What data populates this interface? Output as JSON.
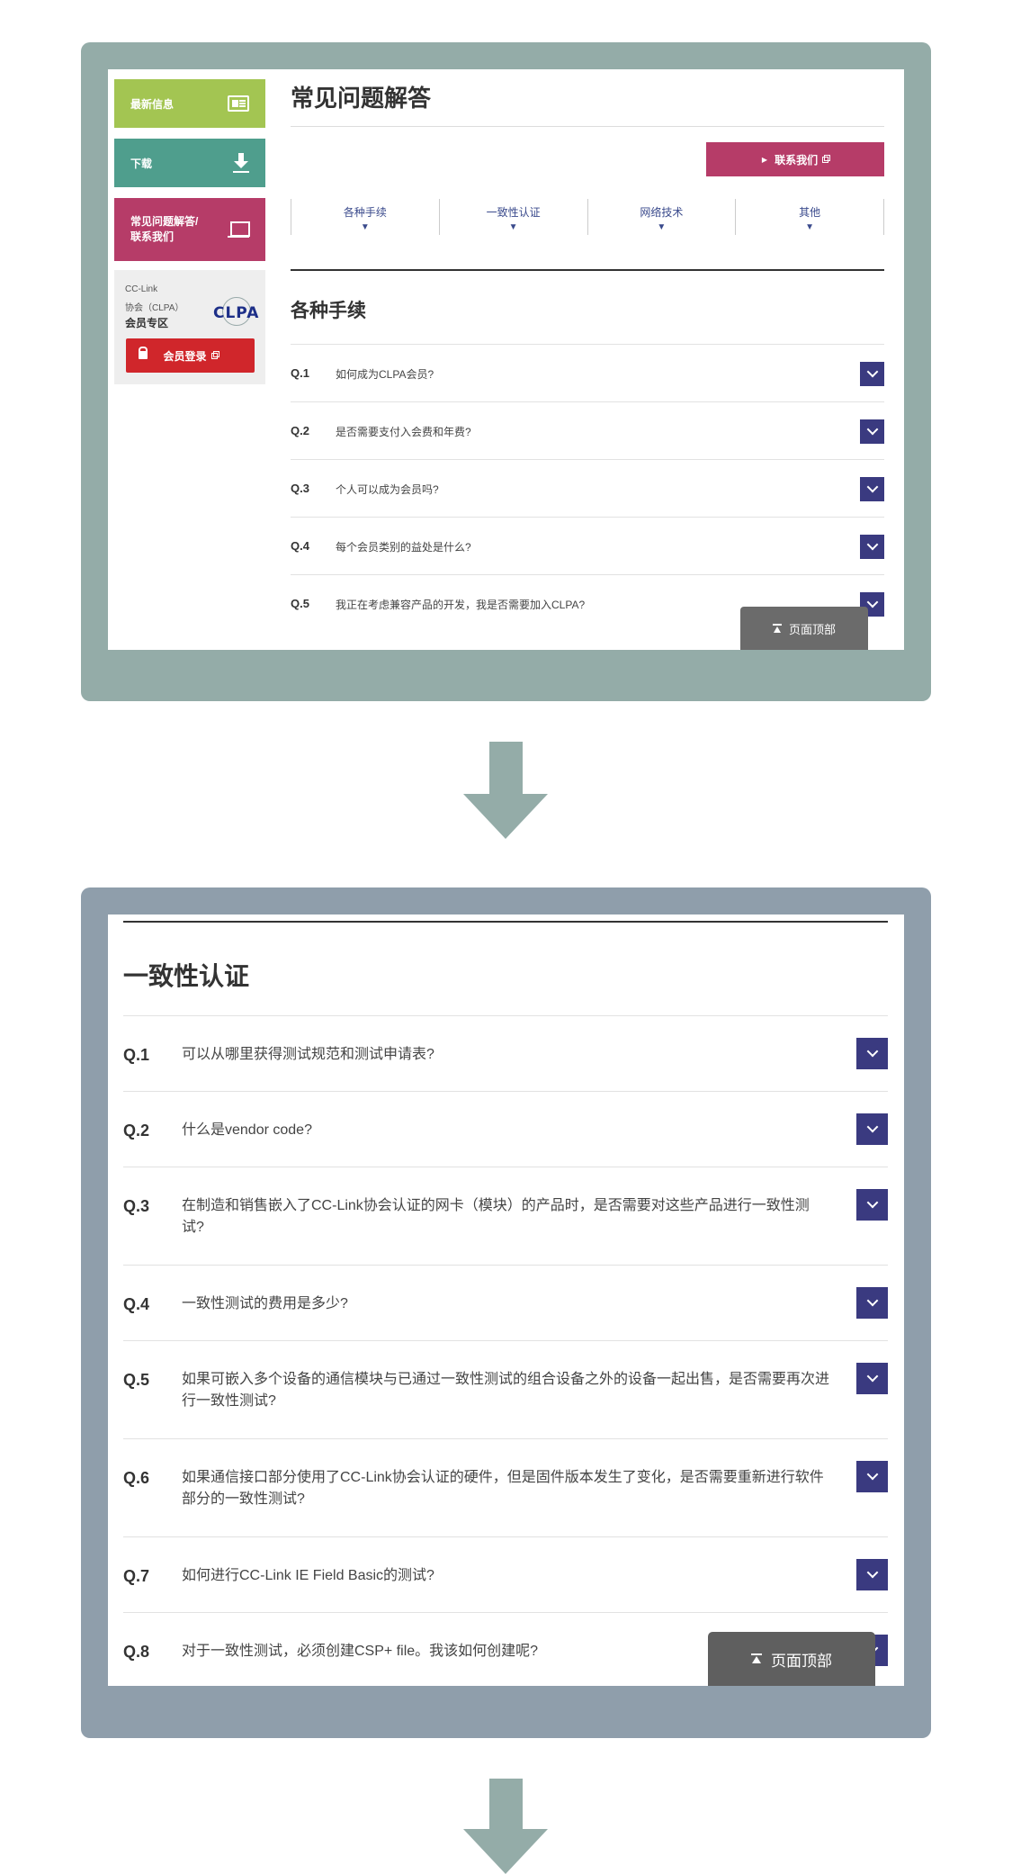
{
  "screen1": {
    "sidebar": {
      "news_label": "最新信息",
      "download_label": "下载",
      "faq_label_line1": "常见问题解答/",
      "faq_label_line2": "联系我们",
      "member_line1": "CC-Link",
      "member_line2": "协会（CLPA）",
      "member_line3": "会员专区",
      "logo_text": "CLPA",
      "login_label": "会员登录"
    },
    "page_title": "常见问题解答",
    "contact_label": "联系我们",
    "tabs": [
      {
        "label": "各种手续"
      },
      {
        "label": "一致性认证"
      },
      {
        "label": "网络技术"
      },
      {
        "label": "其他"
      }
    ],
    "section_title": "各种手续",
    "questions": [
      {
        "num": "Q.1",
        "text": "如何成为CLPA会员?"
      },
      {
        "num": "Q.2",
        "text": "是否需要支付入会费和年费?"
      },
      {
        "num": "Q.3",
        "text": "个人可以成为会员吗?"
      },
      {
        "num": "Q.4",
        "text": "每个会员类别的益处是什么?"
      },
      {
        "num": "Q.5",
        "text": "我正在考虑兼容产品的开发，我是否需要加入CLPA?"
      }
    ],
    "top_label": "页面顶部"
  },
  "screen2": {
    "section_title": "一致性认证",
    "questions": [
      {
        "num": "Q.1",
        "text": "可以从哪里获得测试规范和测试申请表?"
      },
      {
        "num": "Q.2",
        "text": "什么是vendor code?"
      },
      {
        "num": "Q.3",
        "text": "在制造和销售嵌入了CC-Link协会认证的网卡（模块）的产品时，是否需要对这些产品进行一致性测试?"
      },
      {
        "num": "Q.4",
        "text": "一致性测试的费用是多少?"
      },
      {
        "num": "Q.5",
        "text": "如果可嵌入多个设备的通信模块与已通过一致性测试的组合设备之外的设备一起出售，是否需要再次进行一致性测试?"
      },
      {
        "num": "Q.6",
        "text": "如果通信接口部分使用了CC-Link协会认证的硬件，但是固件版本发生了变化，是否需要重新进行软件部分的一致性测试?"
      },
      {
        "num": "Q.7",
        "text": "如何进行CC-Link IE Field Basic的测试?"
      },
      {
        "num": "Q.8",
        "text": "对于一致性测试，必须创建CSP+ file。我该如何创建呢?"
      }
    ],
    "top_label": "页面顶部"
  },
  "colors": {
    "frame1": "#94aca8",
    "frame2": "#8f9eab",
    "news": "#a3c552",
    "download": "#4f9e8d",
    "faq": "#b63c68",
    "login": "#d0262b",
    "chevron": "#3a3a80"
  }
}
